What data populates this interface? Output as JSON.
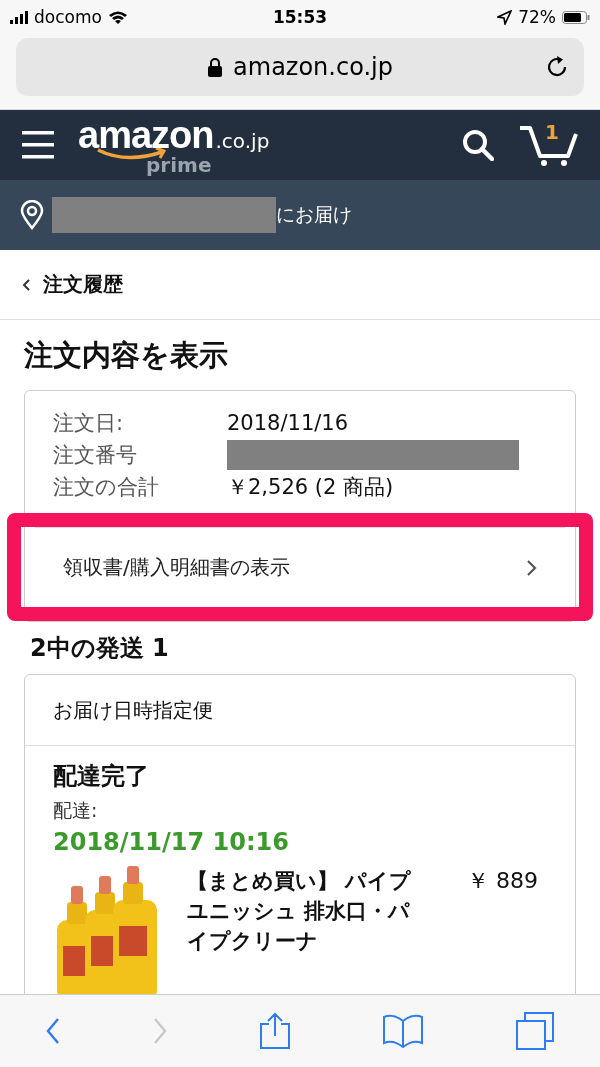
{
  "status_bar": {
    "carrier": "docomo",
    "time": "15:53",
    "battery": "72%"
  },
  "address_bar": {
    "url": "amazon.co.jp"
  },
  "header": {
    "logo_wordmark": "amazon",
    "logo_domain": ".co.jp",
    "logo_tagline": "prime",
    "cart_count": "1"
  },
  "delivery_bar": {
    "text": "にお届け"
  },
  "breadcrumb": {
    "back": "注文履歴"
  },
  "page_title": "注文内容を表示",
  "order_summary": {
    "rows": [
      {
        "kind": "text",
        "label": "注文日:",
        "value": "2018/11/16"
      },
      {
        "kind": "redacted",
        "label": "注文番号"
      },
      {
        "kind": "text",
        "label": "注文の合計",
        "value": "￥2,526 (2 商品)"
      }
    ],
    "receipt_link": {
      "label": "領収書/購入明細書の表示",
      "highlighted": true
    }
  },
  "shipment": {
    "heading": "2中の発送 1",
    "method": "お届け日時指定便",
    "status": "配達完了",
    "delivered_label": "配達:",
    "delivered_at": "2018/11/17 10:16",
    "items": [
      {
        "kind": "picture",
        "title": "【まとめ買い】 パイプユニッシュ 排水口・パイプクリーナ",
        "price": "￥ 889"
      }
    ]
  },
  "toolbar": {
    "back_enabled": true,
    "forward_enabled": false
  }
}
